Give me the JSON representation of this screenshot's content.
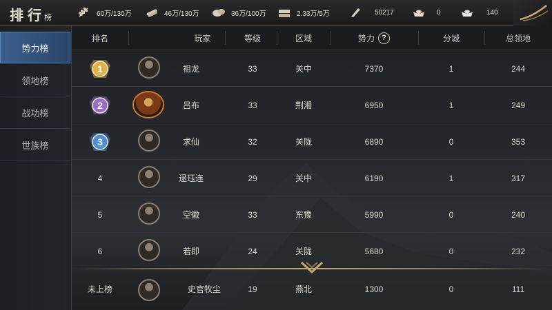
{
  "title": {
    "char1": "排",
    "char2": "行",
    "char3": "榜"
  },
  "resources": [
    {
      "icon": "grain-icon",
      "value": "60万/130万"
    },
    {
      "icon": "wood-icon",
      "value": "46万/130万"
    },
    {
      "icon": "stone-icon",
      "value": "36万/100万"
    },
    {
      "icon": "iron-icon",
      "value": "2.33万/5万"
    },
    {
      "icon": "decree-icon",
      "value": "50217"
    },
    {
      "icon": "gold-ingot-icon",
      "value": "0"
    },
    {
      "icon": "silver-ingot-icon",
      "value": "140"
    }
  ],
  "tabs": [
    {
      "label": "势力榜",
      "active": true
    },
    {
      "label": "领地榜",
      "active": false
    },
    {
      "label": "战功榜",
      "active": false
    },
    {
      "label": "世族榜",
      "active": false
    }
  ],
  "headers": {
    "rank": "排名",
    "player": "玩家",
    "level": "等级",
    "region": "区域",
    "power": "势力",
    "power_help": "?",
    "branch": "分城",
    "territory": "总领地"
  },
  "rows": [
    {
      "rank": "1",
      "medal": "gold",
      "name": "祖龙",
      "level": "33",
      "region": "关中",
      "power": "7370",
      "branch": "1",
      "territory": "244"
    },
    {
      "rank": "2",
      "medal": "purple",
      "name": "吕布",
      "level": "33",
      "region": "荆湘",
      "power": "6950",
      "branch": "1",
      "territory": "249"
    },
    {
      "rank": "3",
      "medal": "blue",
      "name": "求仙",
      "level": "32",
      "region": "关陇",
      "power": "6890",
      "branch": "0",
      "territory": "353"
    },
    {
      "rank": "4",
      "medal": "",
      "name": "逯珏连",
      "level": "29",
      "region": "关中",
      "power": "6190",
      "branch": "1",
      "territory": "317"
    },
    {
      "rank": "5",
      "medal": "",
      "name": "空徽",
      "level": "33",
      "region": "东豫",
      "power": "5990",
      "branch": "0",
      "territory": "240"
    },
    {
      "rank": "6",
      "medal": "",
      "name": "若即",
      "level": "24",
      "region": "关陇",
      "power": "5680",
      "branch": "0",
      "territory": "232"
    }
  ],
  "self_row": {
    "rank": "未上榜",
    "name": "史官牧尘",
    "level": "19",
    "region": "燕北",
    "power": "1300",
    "branch": "0",
    "territory": "111"
  },
  "colors": {
    "gold": "#e0b24a",
    "purple": "#9a6cc9",
    "blue": "#4e8fd8",
    "accent": "#c7a96a"
  }
}
